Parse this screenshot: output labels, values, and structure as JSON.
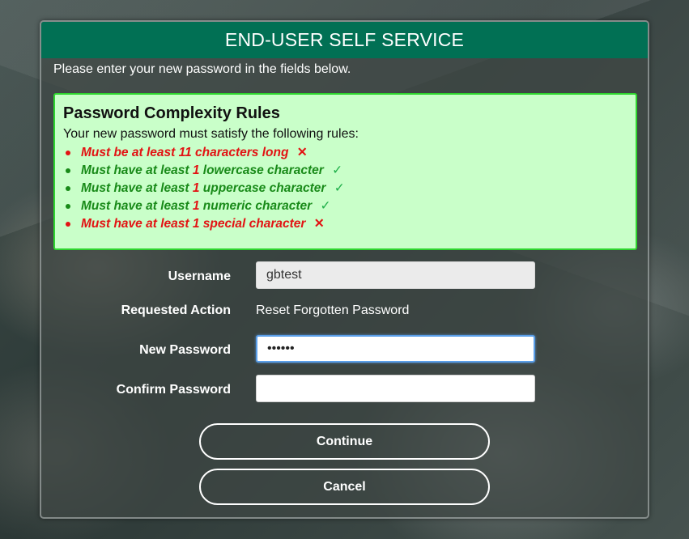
{
  "header": {
    "title": "END-USER SELF SERVICE"
  },
  "intro": "Please enter your new password in the fields below.",
  "rules": {
    "title": "Password Complexity Rules",
    "description": "Your new password must satisfy the following rules:",
    "items": [
      {
        "pre": "Must be at least ",
        "num": "11",
        "post": " characters long",
        "status": "fail"
      },
      {
        "pre": "Must have at least ",
        "num": "1",
        "post": " lowercase character",
        "status": "pass"
      },
      {
        "pre": "Must have at least ",
        "num": "1",
        "post": " uppercase character",
        "status": "pass"
      },
      {
        "pre": "Must have at least ",
        "num": "1",
        "post": " numeric character",
        "status": "pass"
      },
      {
        "pre": "Must have at least ",
        "num": "1",
        "post": " special character",
        "status": "fail"
      }
    ],
    "fail_icon": "✕",
    "pass_icon": "✓"
  },
  "form": {
    "username_label": "Username",
    "username_value": "gbtest",
    "action_label": "Requested Action",
    "action_value": "Reset Forgotten Password",
    "new_password_label": "New Password",
    "new_password_value": "••••••",
    "confirm_password_label": "Confirm Password",
    "confirm_password_value": ""
  },
  "buttons": {
    "continue": "Continue",
    "cancel": "Cancel"
  },
  "colors": {
    "header_bg": "#017054",
    "rules_bg": "#c9ffc9",
    "rules_border": "#2ed52e",
    "fail": "#e21313",
    "pass": "#188a18",
    "check": "#20b04a"
  }
}
